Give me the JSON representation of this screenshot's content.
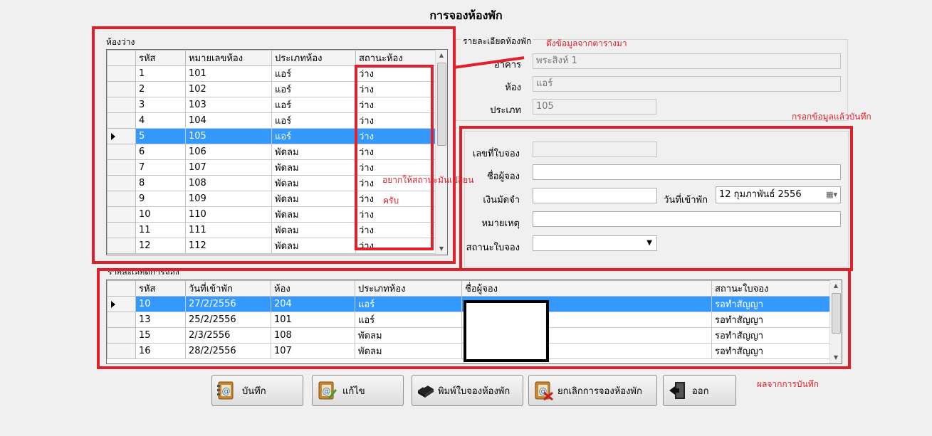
{
  "window_title": "การจองห้องพัก",
  "rooms": {
    "group_label": "ห้องว่าง",
    "columns": [
      "รหัส",
      "หมายเลขห้อง",
      "ประเภทห้อง",
      "สถานะห้อง"
    ],
    "rows": [
      [
        "1",
        "101",
        "แอร์",
        "ว่าง"
      ],
      [
        "2",
        "102",
        "แอร์",
        "ว่าง"
      ],
      [
        "3",
        "103",
        "แอร์",
        "ว่าง"
      ],
      [
        "4",
        "104",
        "แอร์",
        "ว่าง"
      ],
      [
        "5",
        "105",
        "แอร์",
        "ว่าง"
      ],
      [
        "6",
        "106",
        "พัดลม",
        "ว่าง"
      ],
      [
        "7",
        "107",
        "พัดลม",
        "ว่าง"
      ],
      [
        "8",
        "108",
        "พัดลม",
        "ว่าง"
      ],
      [
        "9",
        "109",
        "พัดลม",
        "ว่าง"
      ],
      [
        "10",
        "110",
        "พัดลม",
        "ว่าง"
      ],
      [
        "11",
        "111",
        "พัดลม",
        "ว่าง"
      ],
      [
        "12",
        "112",
        "พัดลม",
        "ว่าง"
      ]
    ],
    "selected_index": 4
  },
  "room_detail": {
    "group_label": "รายละเอียดห้องพัก",
    "building_label": "อาคาร",
    "building_value": "พระสิงห์ 1",
    "room_label": "ห้อง",
    "room_value": "แอร์",
    "type_label": "ประเภท",
    "type_value": "105"
  },
  "booking_form": {
    "booking_no_label": "เลขที่ใบจอง",
    "booking_no_value": "",
    "booker_label": "ชื่อผู้จอง",
    "booker_value": "",
    "deposit_label": "เงินมัดจำ",
    "deposit_value": "",
    "checkin_label": "วันที่เข้าพัก",
    "checkin_value": "12 กุมภาพันธ์   2556",
    "note_label": "หมายเหตุ",
    "note_value": "",
    "status_label": "สถานะใบจอง",
    "status_value": ""
  },
  "bookings": {
    "group_label": "รายละเอียดการจอง",
    "columns": [
      "รหัส",
      "วันที่เข้าพัก",
      "ห้อง",
      "ประเภทห้อง",
      "ชื่อผู้จอง",
      "สถานะใบจอง"
    ],
    "rows": [
      [
        "10",
        "27/2/2556",
        "204",
        "แอร์",
        "",
        "รอทำสัญญา"
      ],
      [
        "13",
        "25/2/2556",
        "101",
        "แอร์",
        "",
        "รอทำสัญญา"
      ],
      [
        "15",
        "2/3/2556",
        "108",
        "พัดลม",
        "",
        "รอทำสัญญา"
      ],
      [
        "16",
        "28/2/2556",
        "107",
        "พัดลม",
        "",
        "รอทำสัญญา"
      ]
    ],
    "selected_index": 0
  },
  "buttons": {
    "save": "บันทึก",
    "edit": "แก้ไข",
    "print": "พิมพ์ใบจองห้องพัก",
    "cancel": "ยกเลิกการจองห้องพัก",
    "exit": "ออก"
  },
  "annotations": {
    "fetch_from_table": "ดึงข้อมูลจากตารางมา",
    "fill_and_save": "กรอกข้อมูลแล้วบันทึก",
    "want_status_change_1": "อยากให้สถานะมันเปลี่ยน",
    "want_status_change_2": "ครับ",
    "result_of_save": "ผลจากการบันทึก"
  },
  "colors": {
    "annotation_red": "#e0202a",
    "selection_blue": "#3399ff"
  }
}
